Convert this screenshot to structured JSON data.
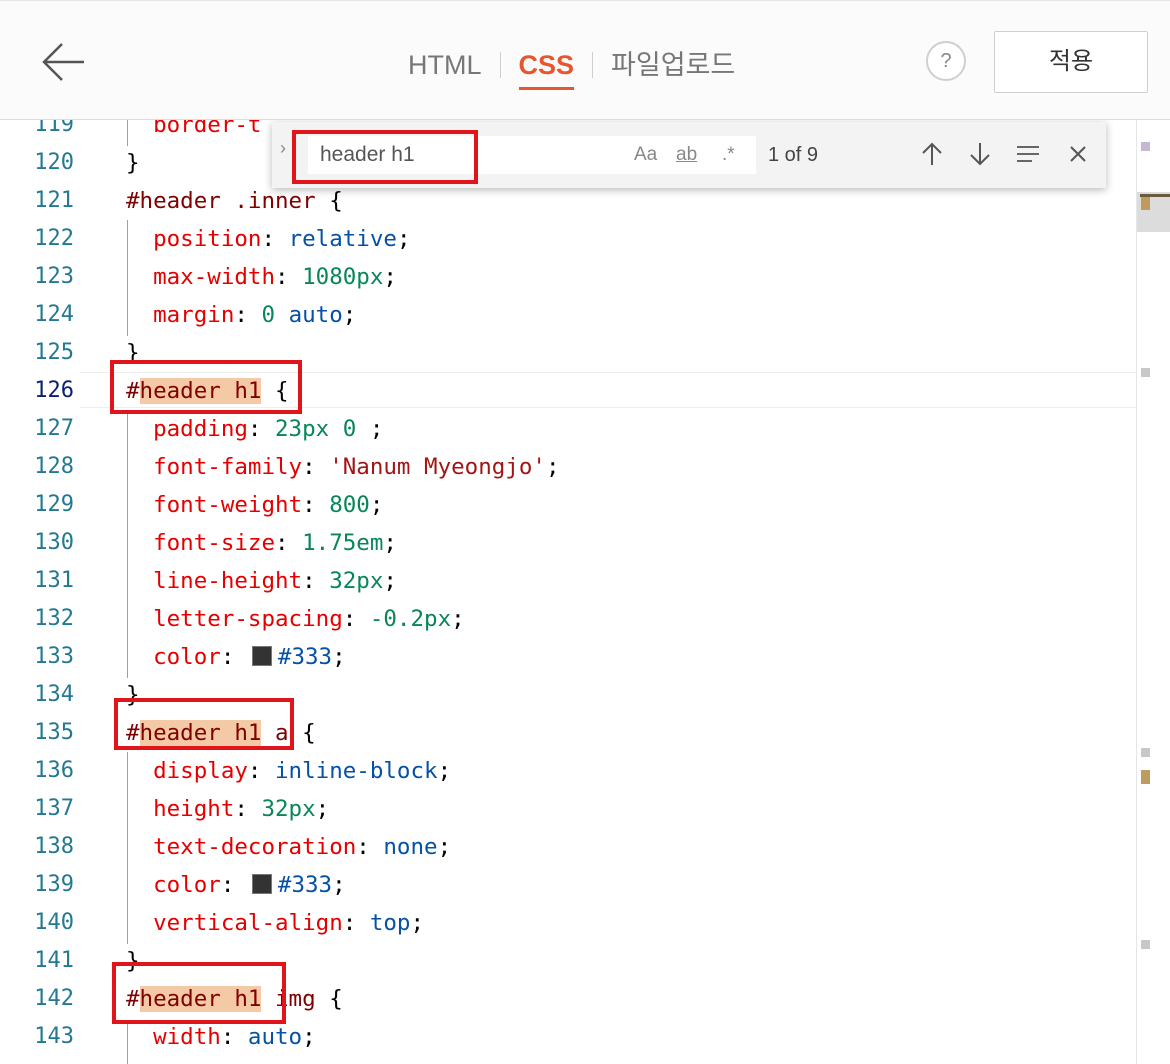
{
  "header": {
    "back_label": "back",
    "tabs": [
      "HTML",
      "CSS",
      "파일업로드"
    ],
    "active_tab": "CSS",
    "help_label": "?",
    "apply_label": "적용"
  },
  "find": {
    "query": "header h1",
    "match_case": "Aa",
    "whole_word": "ab",
    "regex": ".*",
    "count": "1 of 9"
  },
  "editor": {
    "active_line": "126",
    "lines": [
      {
        "n": "119",
        "code": "  border-t"
      },
      {
        "n": "120",
        "code": "}"
      },
      {
        "n": "121",
        "code": "#header .inner {"
      },
      {
        "n": "122",
        "code": "  position: relative;"
      },
      {
        "n": "123",
        "code": "  max-width: 1080px;"
      },
      {
        "n": "124",
        "code": "  margin: 0 auto;"
      },
      {
        "n": "125",
        "code": "}"
      },
      {
        "n": "126",
        "code": "#header h1 {"
      },
      {
        "n": "127",
        "code": "  padding: 23px 0 ;"
      },
      {
        "n": "128",
        "code": "  font-family: 'Nanum Myeongjo';"
      },
      {
        "n": "129",
        "code": "  font-weight: 800;"
      },
      {
        "n": "130",
        "code": "  font-size: 1.75em;"
      },
      {
        "n": "131",
        "code": "  line-height: 32px;"
      },
      {
        "n": "132",
        "code": "  letter-spacing: -0.2px;"
      },
      {
        "n": "133",
        "code": "  color: #333;"
      },
      {
        "n": "134",
        "code": "}"
      },
      {
        "n": "135",
        "code": "#header h1 a {"
      },
      {
        "n": "136",
        "code": "  display: inline-block;"
      },
      {
        "n": "137",
        "code": "  height: 32px;"
      },
      {
        "n": "138",
        "code": "  text-decoration: none;"
      },
      {
        "n": "139",
        "code": "  color: #333;"
      },
      {
        "n": "140",
        "code": "  vertical-align: top;"
      },
      {
        "n": "141",
        "code": "}"
      },
      {
        "n": "142",
        "code": "#header h1 img {"
      },
      {
        "n": "143",
        "code": "  width: auto;"
      }
    ]
  },
  "colors": {
    "accent": "#e8562f",
    "highlight_box": "#e0141b",
    "match_bg": "#f4c9a5",
    "line_number": "#237893",
    "color_swatch": "#333333"
  }
}
